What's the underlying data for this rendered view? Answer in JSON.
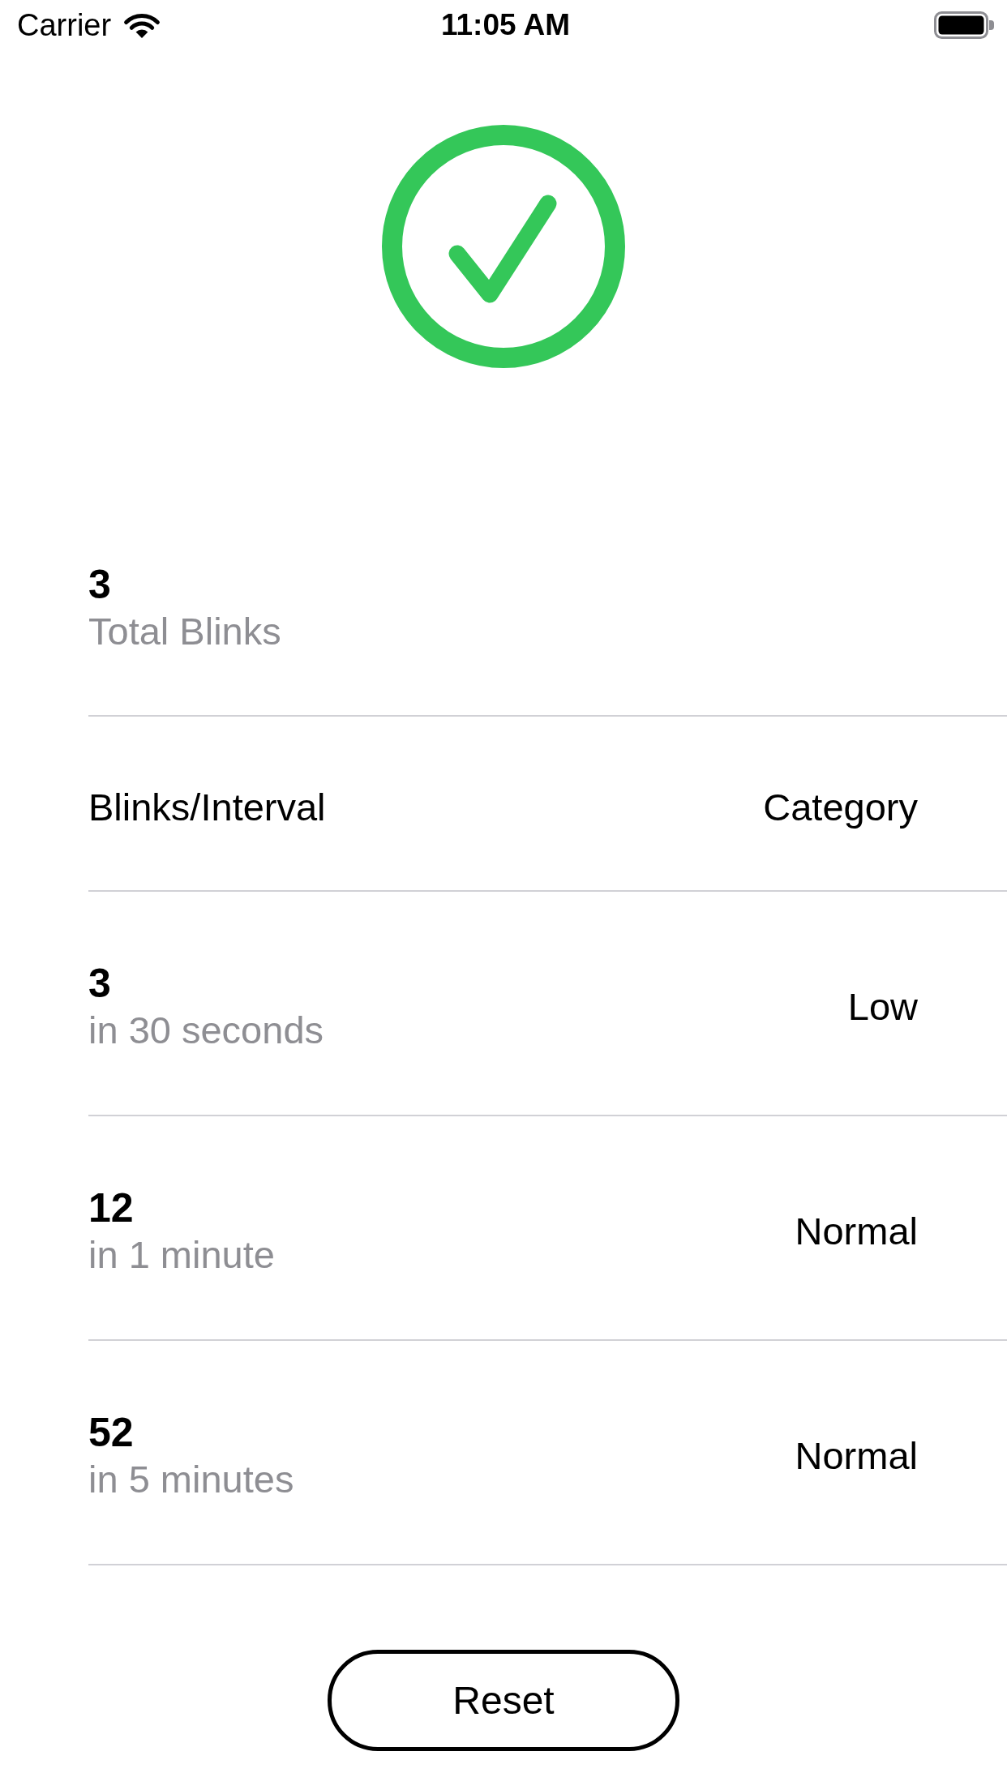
{
  "status_bar": {
    "carrier": "Carrier",
    "time": "11:05 AM"
  },
  "total": {
    "value": "3",
    "label": "Total Blinks"
  },
  "table": {
    "columns": [
      "Blinks/Interval",
      "Category"
    ],
    "rows": [
      {
        "count": "3",
        "interval": "in 30 seconds",
        "category": "Low"
      },
      {
        "count": "12",
        "interval": "in 1 minute",
        "category": "Normal"
      },
      {
        "count": "52",
        "interval": "in 5 minutes",
        "category": "Normal"
      }
    ]
  },
  "reset_button": {
    "label": "Reset"
  }
}
